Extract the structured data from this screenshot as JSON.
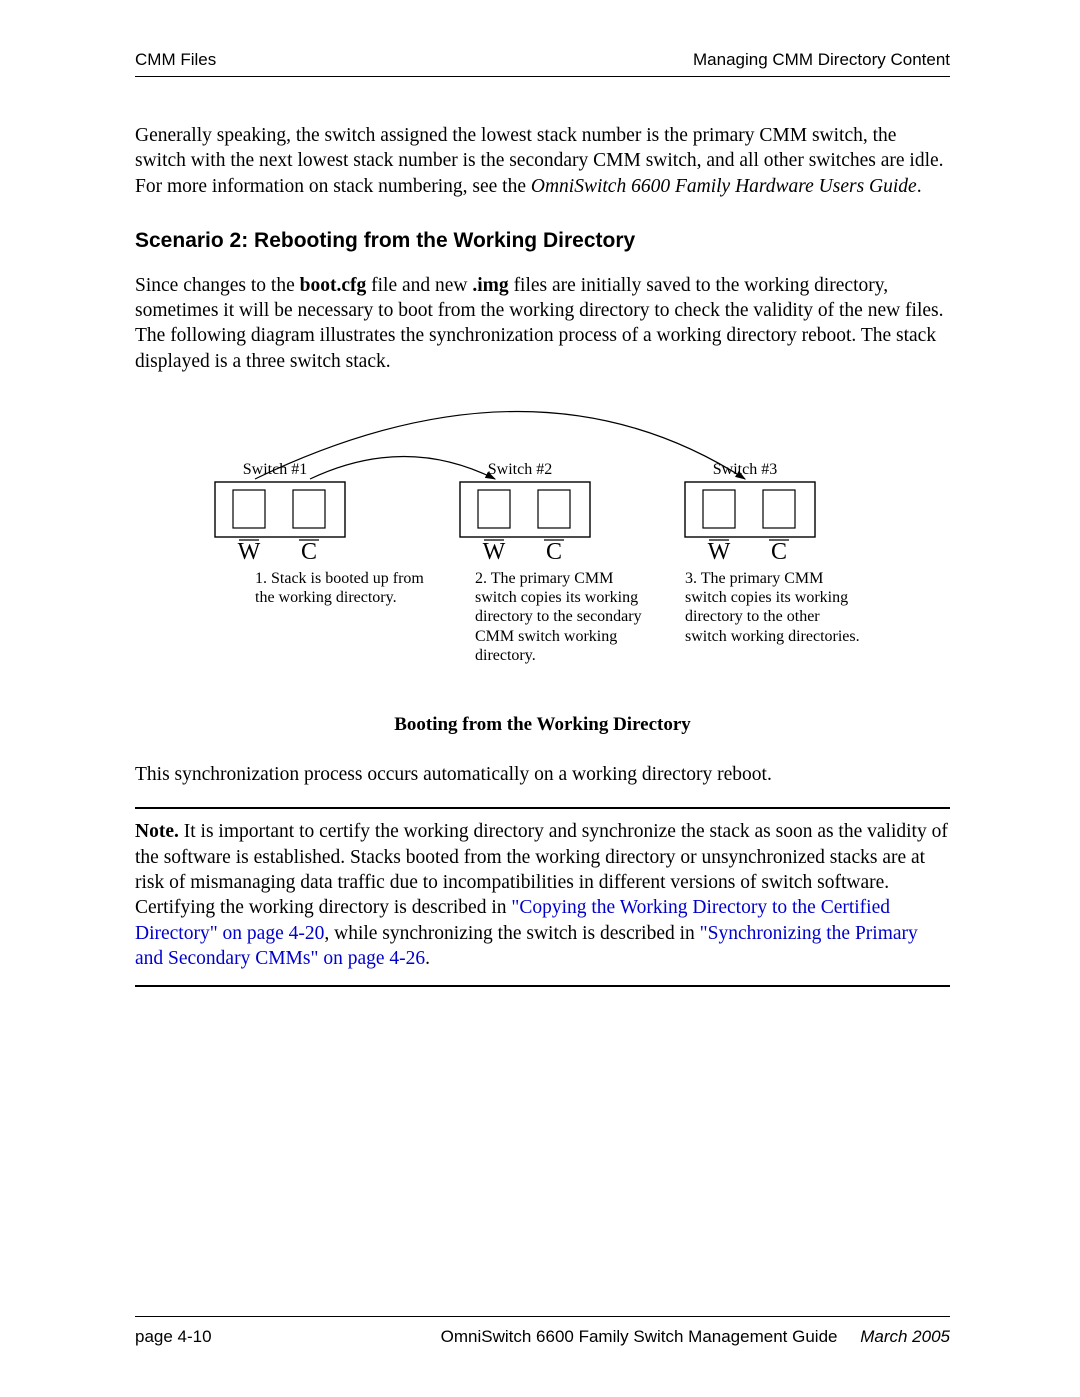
{
  "header": {
    "left": "CMM Files",
    "right": "Managing CMM Directory Content"
  },
  "intro": {
    "text_before_italic": "Generally speaking, the switch assigned the lowest stack number is the primary CMM switch, the switch with the next lowest stack number is the secondary CMM switch, and all other switches are idle. For more information on stack numbering, see the ",
    "italic": "OmniSwitch 6600 Family Hardware Users Guide",
    "text_after_italic": "."
  },
  "h2": "Scenario 2: Rebooting from the Working Directory",
  "p2": {
    "seg1": "Since changes to the ",
    "bold1": "boot.cfg",
    "seg2": " file and new ",
    "bold2": ".img",
    "seg3": " files are initially saved to the working directory, sometimes it will be necessary to boot from the working directory to check the validity of the new files. The following diagram illustrates the synchronization process of a working directory reboot. The stack displayed is a three switch stack."
  },
  "diagram": {
    "switches": [
      {
        "label": "Switch #1",
        "w": "W",
        "c": "C",
        "step": "1. Stack is booted up from the working directory."
      },
      {
        "label": "Switch #2",
        "w": "W",
        "c": "C",
        "step": "2. The primary CMM switch copies its working directory to the secondary CMM switch working directory."
      },
      {
        "label": "Switch #3",
        "w": "W",
        "c": "C",
        "step": "3. The primary CMM switch copies its working directory to the other switch working directories."
      }
    ],
    "caption": "Booting from the Working Directory"
  },
  "p3": "This synchronization process occurs automatically on a working directory reboot.",
  "note": {
    "label": "Note.",
    "seg1": " It is important to certify the working directory and synchronize the stack as soon as the validity of the software is established. Stacks booted from the working directory or unsynchronized stacks are at risk of mismanaging data traffic due to incompatibilities in different versions of switch software. Certifying the working directory is described in ",
    "link1": "\"Copying the Working Directory to the Certified Directory\" on page 4-20",
    "seg2": ", while synchronizing the switch is described in ",
    "link2": "\"Synchronizing the Primary and Secondary CMMs\" on page 4-26",
    "seg3": "."
  },
  "footer": {
    "left": "page 4-10",
    "guide": "OmniSwitch 6600 Family Switch Management Guide",
    "date": "March 2005"
  }
}
